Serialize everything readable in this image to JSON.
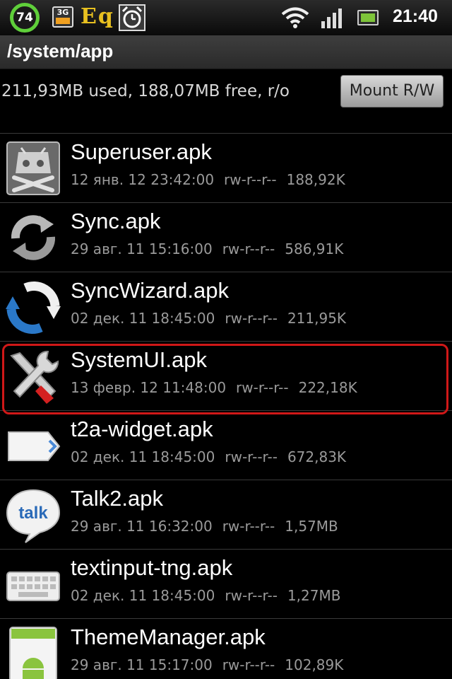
{
  "status_bar": {
    "battery_level": "74",
    "network_type": "3G",
    "eq_label": "Eq",
    "time": "21:40",
    "icons": [
      "battery-widget-icon",
      "3g-icon",
      "equalizer-icon",
      "alarm-icon",
      "wifi-icon",
      "signal-icon",
      "battery-icon"
    ]
  },
  "path": "/system/app",
  "storage_info": "211,93MB used, 188,07MB free, r/o",
  "mount_button": "Mount R/W",
  "files": [
    {
      "name": "Superuser.apk",
      "date": "12 янв. 12 23:42:00",
      "perms": "rw-r--r--",
      "size": "188,92K",
      "icon": "superuser-icon"
    },
    {
      "name": "Sync.apk",
      "date": "29 авг. 11 15:16:00",
      "perms": "rw-r--r--",
      "size": "586,91K",
      "icon": "sync-icon"
    },
    {
      "name": "SyncWizard.apk",
      "date": "02 дек. 11 18:45:00",
      "perms": "rw-r--r--",
      "size": "211,95K",
      "icon": "sync-wizard-icon"
    },
    {
      "name": "SystemUI.apk",
      "date": "13 февр. 12 11:48:00",
      "perms": "rw-r--r--",
      "size": "222,18K",
      "icon": "tools-icon"
    },
    {
      "name": "t2a-widget.apk",
      "date": "02 дек. 11 18:45:00",
      "perms": "rw-r--r--",
      "size": "672,83K",
      "icon": "tag-icon"
    },
    {
      "name": "Talk2.apk",
      "date": "29 авг. 11 16:32:00",
      "perms": "rw-r--r--",
      "size": "1,57MB",
      "icon": "talk-icon"
    },
    {
      "name": "textinput-tng.apk",
      "date": "02 дек. 11 18:45:00",
      "perms": "rw-r--r--",
      "size": "1,27MB",
      "icon": "keyboard-icon"
    },
    {
      "name": "ThemeManager.apk",
      "date": "29 авг. 11 15:17:00",
      "perms": "rw-r--r--",
      "size": "102,89K",
      "icon": "android-theme-icon"
    }
  ],
  "talk_icon_text": "talk",
  "highlight_color": "#d01818",
  "accent_colors": {
    "battery_ring": "#5fcf3a",
    "eq": "#e8c020"
  }
}
